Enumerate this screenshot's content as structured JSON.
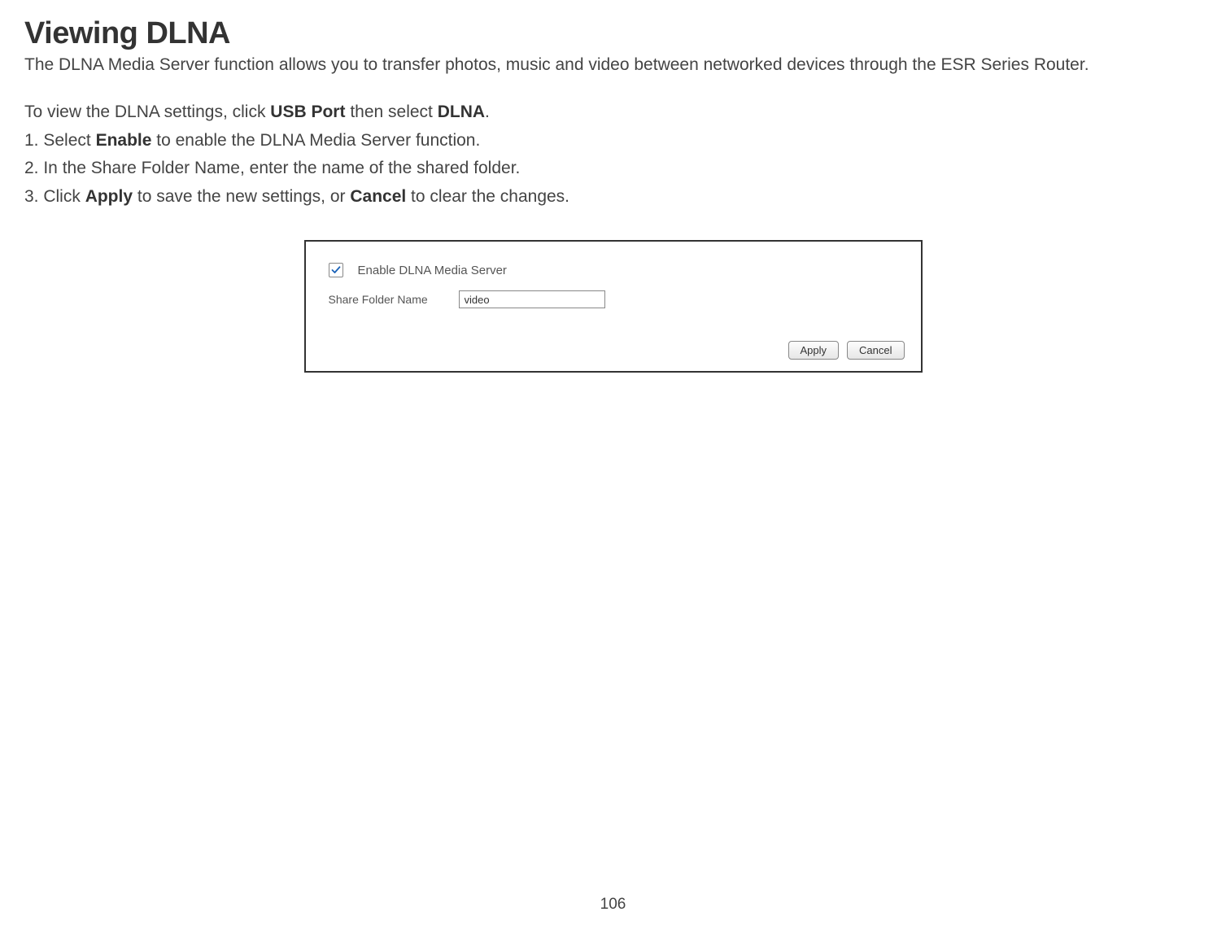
{
  "heading": "Viewing DLNA",
  "intro": "The DLNA Media Server function allows you to transfer photos, music and video between networked devices through the ESR Series Router.",
  "nav_line": {
    "pre": "To view the DLNA settings, click ",
    "b1": "USB Port",
    "mid": " then select ",
    "b2": "DLNA",
    "post": "."
  },
  "steps": {
    "s1": {
      "pre": "1. Select ",
      "b": "Enable",
      "post": " to enable the DLNA Media Server function."
    },
    "s2": "2. In the Share Folder Name, enter the name of the shared folder.",
    "s3": {
      "pre": "3. Click ",
      "b1": "Apply",
      "mid": " to save the new settings, or ",
      "b2": "Cancel",
      "post": " to clear the changes."
    }
  },
  "panel": {
    "checkbox_label": "Enable DLNA Media Server",
    "field_label": "Share Folder Name",
    "field_value": "video",
    "apply": "Apply",
    "cancel": "Cancel"
  },
  "page_number": "106"
}
